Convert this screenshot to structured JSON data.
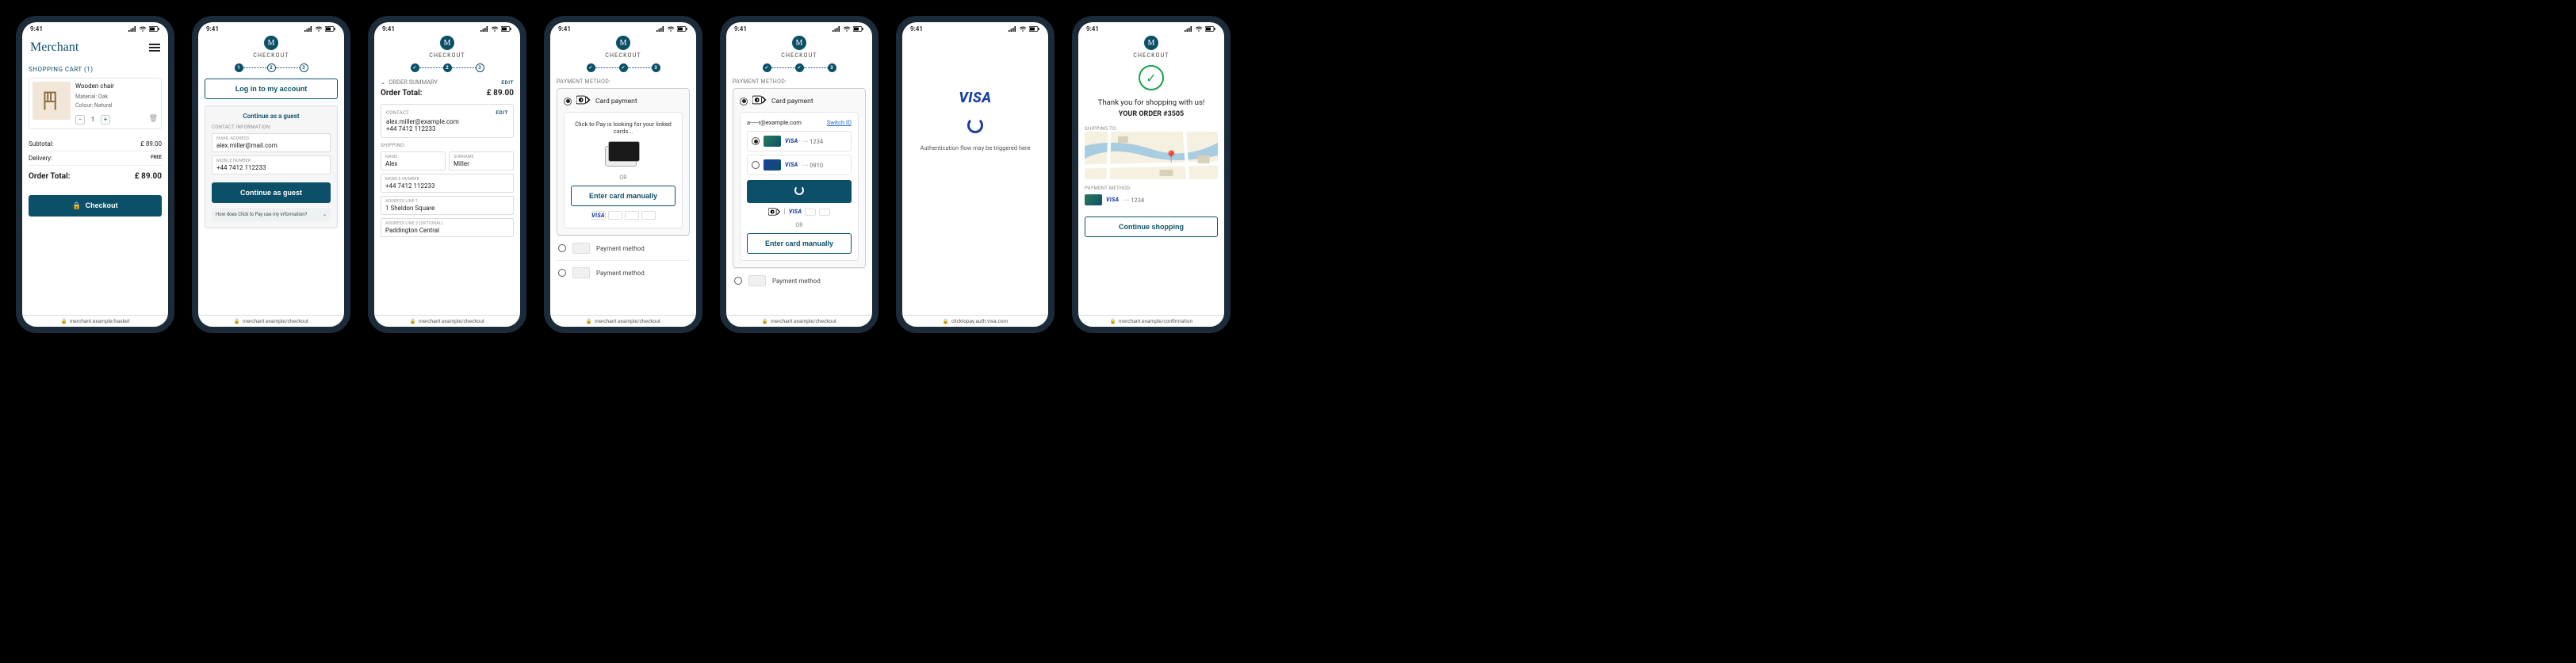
{
  "status": {
    "time": "9:41"
  },
  "urls": {
    "basket": "merchant.example/basket",
    "checkout": "merchant.example/checkout",
    "auth": "clicktopay.auth.visa.com",
    "confirm": "merchant.example/confirmation"
  },
  "s1": {
    "brand": "Merchant",
    "cart_title": "SHOPPING CART (1)",
    "item": {
      "name": "Wooden chair",
      "material": "Material: Oak",
      "colour": "Colour: Natural",
      "qty": "1"
    },
    "subtotal_label": "Subtotal:",
    "subtotal": "£ 89.00",
    "delivery_label": "Delivery:",
    "delivery": "FREE",
    "total_label": "Order Total:",
    "total": "£ 89.00",
    "checkout_btn": "Checkout"
  },
  "ck": {
    "title": "CHECKOUT"
  },
  "s2": {
    "login_btn": "Log in to my account",
    "guest_title": "Continue as a guest",
    "contact_label": "CONTACT INFORMATION:",
    "email_label": "EMAIL ADDRESS",
    "email": "alex.miller@mail.com",
    "mobile_label": "MOBILE NUMBER",
    "mobile": "+44 7412 112233",
    "continue_btn": "Continue as guest",
    "footnote": "How does Click to Pay use my information?"
  },
  "s3": {
    "summary": "ORDER SUMMARY",
    "edit": "EDIT",
    "total_label": "Order Total:",
    "total": "£ 89.00",
    "contact_label": "CONTACT",
    "email": "alex.miller@example.com",
    "mobile": "+44 7412 112233",
    "shipping_label": "SHIPPING:",
    "name_label": "NAME",
    "name": "Alex",
    "surname_label": "SURNAME",
    "surname": "Miller",
    "mobile_label": "MOBILE NUMBER",
    "mobile2": "+44 7412 112233",
    "addr1_label": "ADDRESS LINE 1",
    "addr1": "1 Sheldon Square",
    "addr2_label": "ADDRESS LINE 2 (OPTIONAL)",
    "addr2": "Paddington Central"
  },
  "s4": {
    "pm_label": "PAYMENT METHOD:",
    "card_pay": "Card payment",
    "looking": "Click to Pay is looking for your linked cards...",
    "or": "OR",
    "manual": "Enter card manually",
    "pm_generic": "Payment method"
  },
  "s5": {
    "pm_label": "PAYMENT METHOD:",
    "card_pay": "Card payment",
    "email": "a-----r@example.com",
    "switch": "Switch ID",
    "card1": "···· 1234",
    "card2": "···· 0910",
    "or": "OR",
    "manual": "Enter card manually",
    "pm_generic": "Payment method"
  },
  "s6": {
    "visa": "VISA",
    "note": "Authentication flow may be triggered here"
  },
  "s7": {
    "thanks": "Thank you for shopping with us!",
    "order": "YOUR ORDER #3505",
    "ship_label": "SHIPPING TO:",
    "pm_label": "PAYMENT METHOD:",
    "card": "···· 1234",
    "continue": "Continue shopping"
  }
}
